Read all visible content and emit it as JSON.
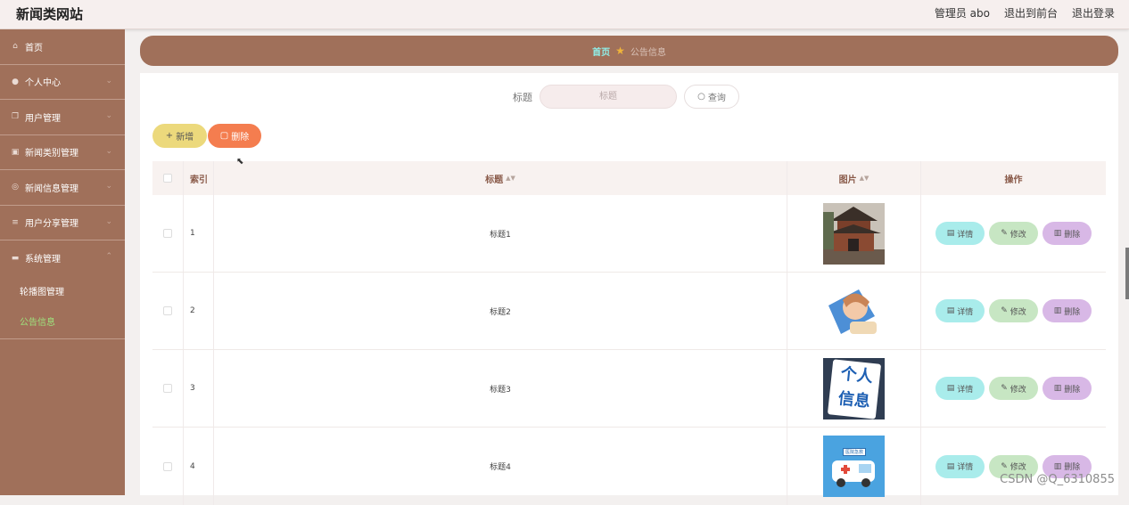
{
  "header": {
    "site_title": "新闻类网站",
    "admin_label": "管理员 abo",
    "to_front": "退出到前台",
    "logout": "退出登录"
  },
  "sidebar": {
    "items": [
      {
        "label": "首页",
        "icon": "home-icon",
        "has_chevron": false
      },
      {
        "label": "个人中心",
        "icon": "user-icon",
        "has_chevron": true
      },
      {
        "label": "用户管理",
        "icon": "users-icon",
        "has_chevron": true
      },
      {
        "label": "新闻类别管理",
        "icon": "category-icon",
        "has_chevron": true
      },
      {
        "label": "新闻信息管理",
        "icon": "news-icon",
        "has_chevron": true
      },
      {
        "label": "用户分享管理",
        "icon": "share-icon",
        "has_chevron": true
      },
      {
        "label": "系统管理",
        "icon": "system-icon",
        "has_chevron": true
      }
    ],
    "sub_items": [
      {
        "label": "轮播图管理",
        "active": false
      },
      {
        "label": "公告信息",
        "active": true
      }
    ]
  },
  "breadcrumb": {
    "home": "首页",
    "current": "公告信息"
  },
  "search": {
    "label": "标题",
    "placeholder": "标题",
    "button": "查询"
  },
  "actions": {
    "add": "新增",
    "delete": "删除"
  },
  "table": {
    "headers": {
      "index": "索引",
      "title": "标题",
      "image": "图片",
      "ops": "操作"
    },
    "op_labels": {
      "detail": "详情",
      "edit": "修改",
      "remove": "删除"
    },
    "rows": [
      {
        "index": "1",
        "title": "标题1",
        "image": "pagoda"
      },
      {
        "index": "2",
        "title": "标题2",
        "image": "sleeping-person"
      },
      {
        "index": "3",
        "title": "标题3",
        "image": "personal-info"
      },
      {
        "index": "4",
        "title": "标题4",
        "image": "ambulance"
      }
    ]
  },
  "image_text": {
    "personal_info": "个人信息",
    "ambulance_sign": "医院急救"
  },
  "watermark": "CSDN @Q_6310855",
  "colors": {
    "sidebar_bg": "#a0705a",
    "accent_active": "#9ee37d",
    "delete_btn": "#f47d4f",
    "add_btn": "#ecd97c"
  }
}
